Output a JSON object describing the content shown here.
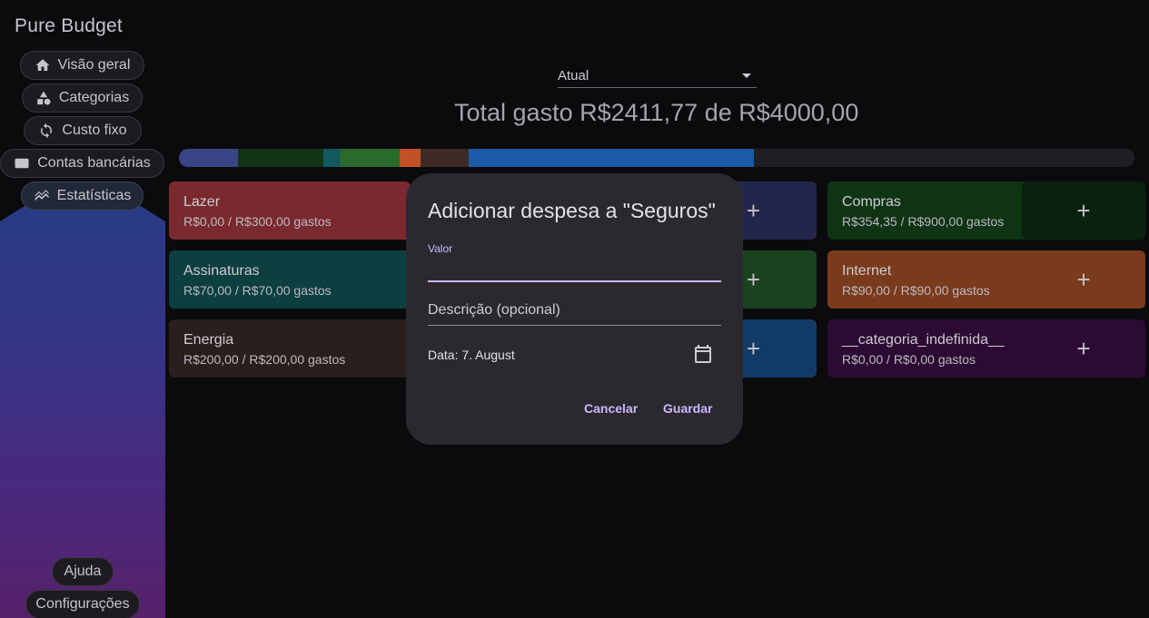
{
  "app": {
    "title": "Pure Budget"
  },
  "nav": {
    "overview": "Visão geral",
    "categories": "Categorias",
    "fixed_cost": "Custo fixo",
    "bank_accounts": "Contas bancárias",
    "statistics": "Estatísticas",
    "help": "Ajuda",
    "settings": "Configurações"
  },
  "header": {
    "period": "Atual",
    "total": "Total gasto R$2411,77 de R$4000,00"
  },
  "bar_segments": [
    {
      "color": "#3a4585",
      "fraction": 0.062
    },
    {
      "color": "#123516",
      "fraction": 0.089
    },
    {
      "color": "#12585f",
      "fraction": 0.017
    },
    {
      "color": "#2a6a2a",
      "fraction": 0.063
    },
    {
      "color": "#c2512a",
      "fraction": 0.022
    },
    {
      "color": "#3d2a24",
      "fraction": 0.05
    },
    {
      "color": "#1a5aa8",
      "fraction": 0.299
    }
  ],
  "cards": [
    {
      "name": "Lazer",
      "amount": "R$0,00 / R$300,00 gastos",
      "bg": "#7a2a2e",
      "plus": "+"
    },
    {
      "name": "Assinaturas",
      "amount": "R$70,00 / R$70,00 gastos",
      "bg": "#0c3f3f",
      "plus": "+"
    },
    {
      "name": "Energia",
      "amount": "R$200,00 / R$200,00 gastos",
      "bg": "#2a1f1d",
      "plus": "+"
    },
    {
      "name": "",
      "amount": "",
      "bg": "#23264a",
      "plus": "+"
    },
    {
      "name": "",
      "amount": "",
      "bg": "#1b4220",
      "plus": "+"
    },
    {
      "name": "",
      "amount": "",
      "bg": "#123a66",
      "plus": "+"
    },
    {
      "name": "Compras",
      "amount": "R$354,35 / R$900,00 gastos",
      "bg": "#0f3414",
      "plus": "+"
    },
    {
      "name": "Internet",
      "amount": "R$90,00 / R$90,00 gastos",
      "bg": "#7a3a1c",
      "plus": "+"
    },
    {
      "name": "__categoria_indefinida__",
      "amount": "R$0,00 / R$0,00 gastos",
      "bg": "#2b0b33",
      "plus": "+"
    }
  ],
  "dialog": {
    "title": "Adicionar despesa a \"Seguros\"",
    "value_label": "Valor",
    "value": "",
    "description_placeholder": "Descrição (opcional)",
    "date": "Data: 7. August",
    "cancel": "Cancelar",
    "save": "Guardar"
  }
}
